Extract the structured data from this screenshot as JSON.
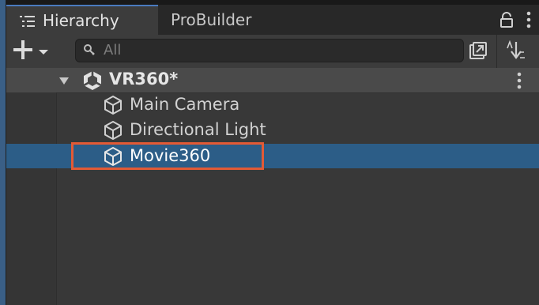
{
  "tabs": [
    {
      "label": "Hierarchy",
      "active": true
    },
    {
      "label": "ProBuilder",
      "active": false
    }
  ],
  "toolbar": {
    "search_placeholder": "All",
    "search_value": ""
  },
  "scene": {
    "name": "VR360*",
    "expanded": true
  },
  "objects": [
    {
      "label": "Main Camera",
      "selected": false
    },
    {
      "label": "Directional Light",
      "selected": false
    },
    {
      "label": "Movie360",
      "selected": true
    }
  ],
  "colors": {
    "selection": "#2c5d87",
    "highlight_box": "#e35a35",
    "panel_bg": "#383838"
  },
  "icons": [
    "list-icon",
    "lock-icon",
    "kebab-menu-icon",
    "plus-icon",
    "dropdown-arrow-icon",
    "search-icon",
    "popout-icon",
    "sort-icon",
    "fold-arrow-icon",
    "unity-scene-icon",
    "gameobject-cube-icon"
  ]
}
